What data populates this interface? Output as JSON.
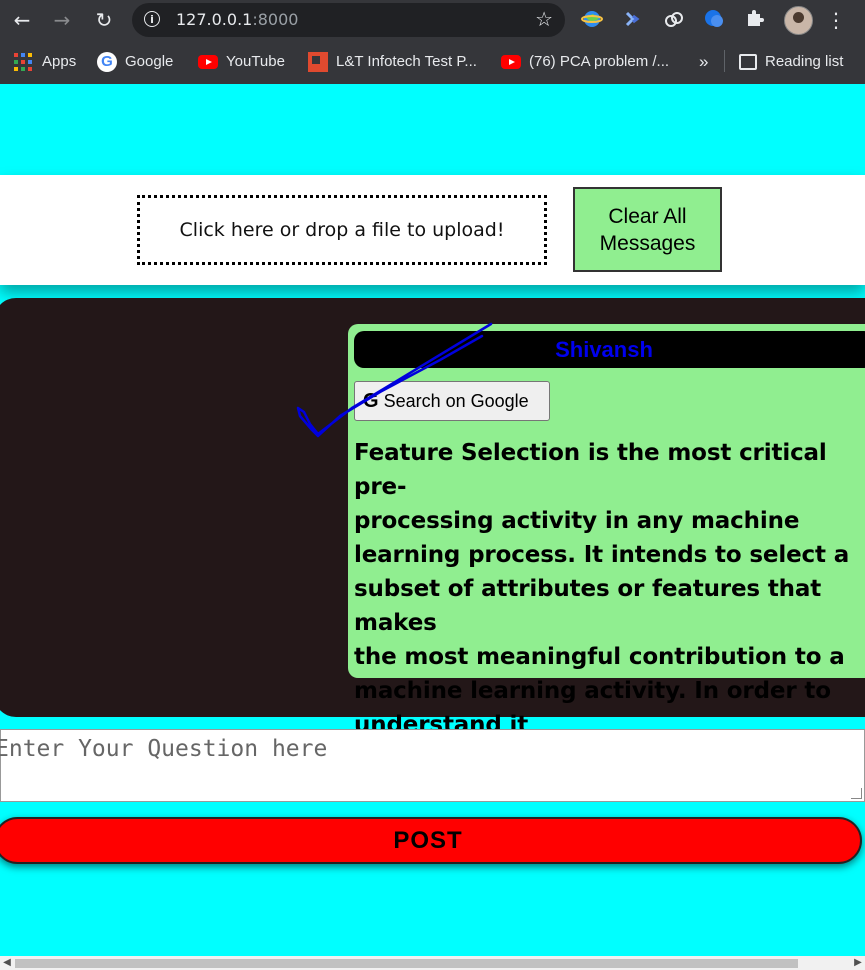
{
  "browser": {
    "url_host": "127.0.0.1",
    "url_port": ":8000",
    "bookmarks": [
      {
        "label": "Apps",
        "icon": "apps-grid-icon"
      },
      {
        "label": "Google",
        "icon": "google-icon"
      },
      {
        "label": "YouTube",
        "icon": "youtube-icon"
      },
      {
        "label": "L&T Infotech Test P...",
        "icon": "lt-infotech-icon"
      },
      {
        "label": "(76) PCA problem /...",
        "icon": "youtube-icon"
      }
    ],
    "overflow_label": "»",
    "reading_list_label": "Reading list"
  },
  "upload": {
    "dropzone_label": "Click here or drop a file to upload!",
    "clear_button_label": "Clear All\nMessages"
  },
  "chat": {
    "message": {
      "sender": "Shivansh",
      "search_button_label": "Search on Google",
      "text": "Feature Selection is the most critical pre-\nprocessing activity in any machine\nlearning process. It intends to select a\nsubset of attributes or features that makes\nthe most meaningful contribution to a\nmachine learning activity. In order to\nunderstand it"
    }
  },
  "question": {
    "placeholder": "Enter Your Question here"
  },
  "post": {
    "label": "POST"
  },
  "colors": {
    "page_background": "#00ffff",
    "chat_panel": "#231718",
    "message_bubble": "#90ee90",
    "sender_name": "#0000ee",
    "post_button": "#ff0000"
  }
}
